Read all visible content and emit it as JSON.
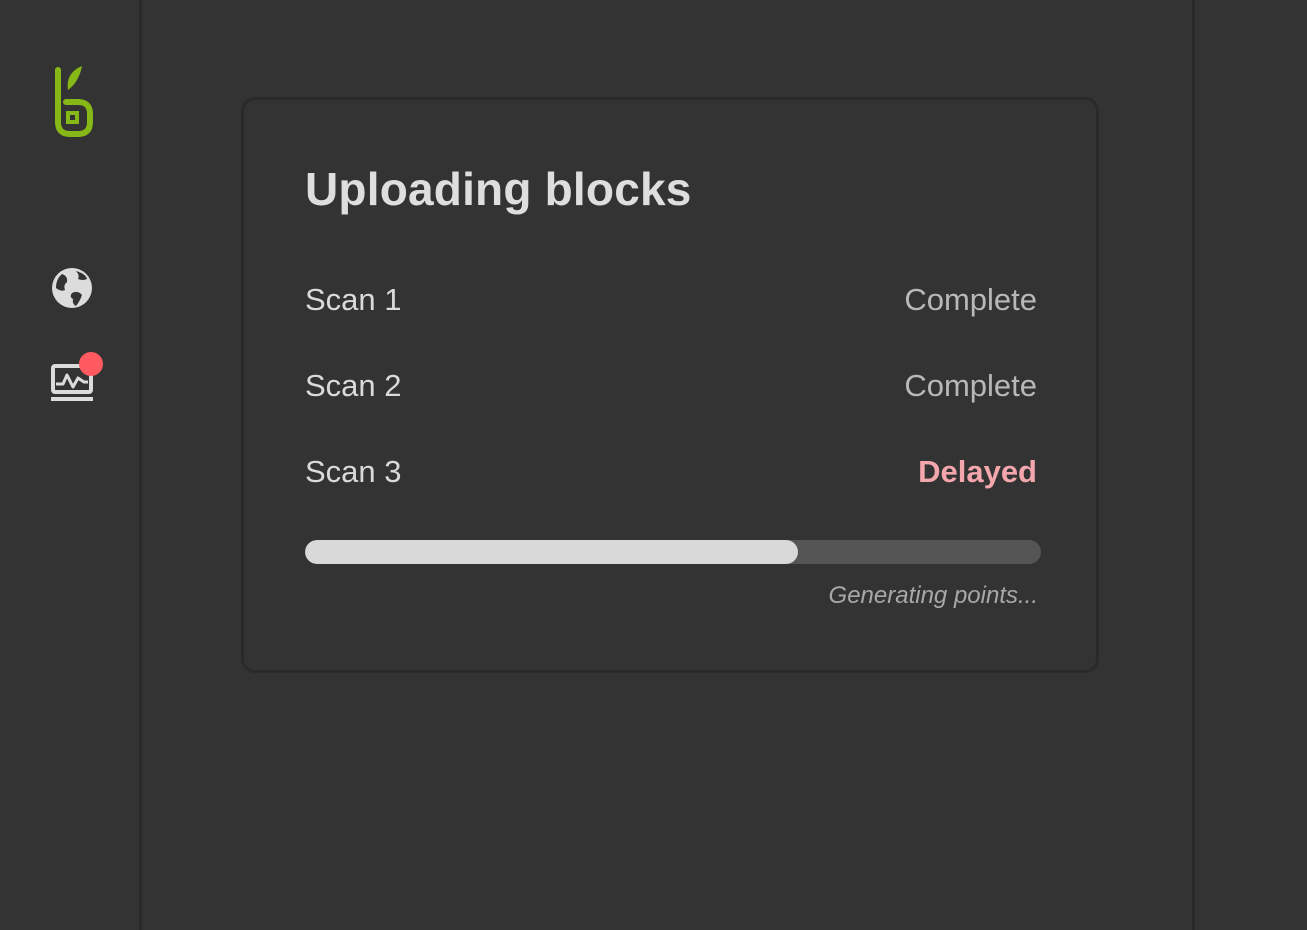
{
  "sidebar": {
    "logo": "sprout-logo",
    "items": [
      {
        "icon": "globe-icon"
      },
      {
        "icon": "monitor-activity-icon",
        "notification": true
      }
    ],
    "notification_color": "#ff5a5f"
  },
  "card": {
    "title": "Uploading blocks",
    "scans": [
      {
        "label": "Scan 1",
        "status": "Complete"
      },
      {
        "label": "Scan 2",
        "status": "Complete"
      },
      {
        "label": "Scan 3",
        "status": "Delayed"
      }
    ],
    "progress": {
      "fraction": 0.67,
      "caption": "Generating points..."
    }
  },
  "colors": {
    "background": "#333333",
    "brand_green": "#86b817",
    "delayed": "#f3a6ac"
  }
}
